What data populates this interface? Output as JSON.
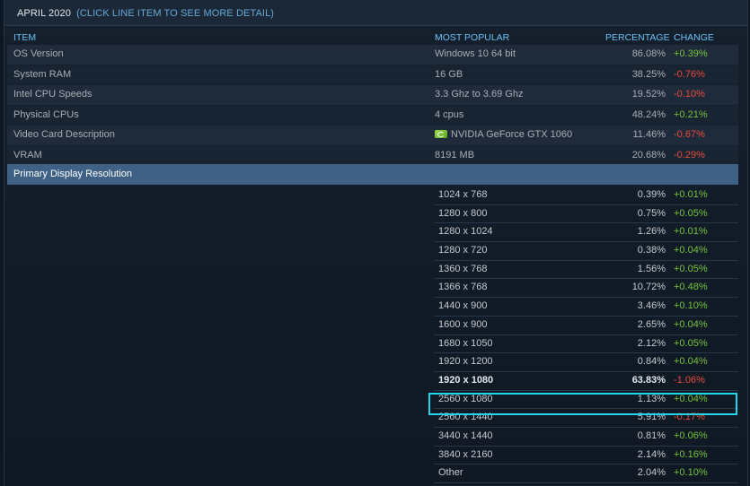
{
  "header": {
    "title": "APRIL 2020",
    "note": "(CLICK LINE ITEM TO SEE MORE DETAIL)"
  },
  "columns": {
    "item": "ITEM",
    "most_popular": "MOST POPULAR",
    "percentage": "PERCENTAGE",
    "change": "CHANGE"
  },
  "rows": [
    {
      "item": "OS Version",
      "popular": "Windows 10 64 bit",
      "percentage": "86.08%",
      "change": "+0.39%",
      "trend": "pos"
    },
    {
      "item": "System RAM",
      "popular": "16 GB",
      "percentage": "38.25%",
      "change": "-0.76%",
      "trend": "neg"
    },
    {
      "item": "Intel CPU Speeds",
      "popular": "3.3 Ghz to 3.69 Ghz",
      "percentage": "19.52%",
      "change": "-0.10%",
      "trend": "neg"
    },
    {
      "item": "Physical CPUs",
      "popular": "4 cpus",
      "percentage": "48.24%",
      "change": "+0.21%",
      "trend": "pos"
    },
    {
      "item": "Video Card Description",
      "popular": "NVIDIA GeForce GTX 1060",
      "percentage": "11.46%",
      "change": "-0.67%",
      "trend": "neg",
      "icon": "nvidia-logo-icon"
    },
    {
      "item": "VRAM",
      "popular": "8191 MB",
      "percentage": "20.68%",
      "change": "-0.29%",
      "trend": "neg"
    }
  ],
  "section": {
    "label": "Primary Display Resolution"
  },
  "resolutions": [
    {
      "res": "1024 x 768",
      "percentage": "0.39%",
      "change": "+0.01%",
      "trend": "pos"
    },
    {
      "res": "1280 x 800",
      "percentage": "0.75%",
      "change": "+0.05%",
      "trend": "pos"
    },
    {
      "res": "1280 x 1024",
      "percentage": "1.26%",
      "change": "+0.01%",
      "trend": "pos"
    },
    {
      "res": "1280 x 720",
      "percentage": "0.38%",
      "change": "+0.04%",
      "trend": "pos"
    },
    {
      "res": "1360 x 768",
      "percentage": "1.56%",
      "change": "+0.05%",
      "trend": "pos"
    },
    {
      "res": "1366 x 768",
      "percentage": "10.72%",
      "change": "+0.48%",
      "trend": "pos"
    },
    {
      "res": "1440 x 900",
      "percentage": "3.46%",
      "change": "+0.10%",
      "trend": "pos"
    },
    {
      "res": "1600 x 900",
      "percentage": "2.65%",
      "change": "+0.04%",
      "trend": "pos"
    },
    {
      "res": "1680 x 1050",
      "percentage": "2.12%",
      "change": "+0.05%",
      "trend": "pos"
    },
    {
      "res": "1920 x 1200",
      "percentage": "0.84%",
      "change": "+0.04%",
      "trend": "pos"
    },
    {
      "res": "1920 x 1080",
      "percentage": "63.83%",
      "change": "-1.06%",
      "trend": "neg",
      "bold": true
    },
    {
      "res": "2560 x 1080",
      "percentage": "1.13%",
      "change": "+0.04%",
      "trend": "pos"
    },
    {
      "res": "2560 x 1440",
      "percentage": "5.91%",
      "change": "-0.17%",
      "trend": "neg",
      "highlighted": true
    },
    {
      "res": "3440 x 1440",
      "percentage": "0.81%",
      "change": "+0.06%",
      "trend": "pos"
    },
    {
      "res": "3840 x 2160",
      "percentage": "2.14%",
      "change": "+0.16%",
      "trend": "pos"
    },
    {
      "res": "Other",
      "percentage": "2.04%",
      "change": "+0.10%",
      "trend": "pos"
    }
  ],
  "colors": {
    "positive": "#76c23c",
    "negative": "#ea4b3c",
    "header_text": "#67c1f5",
    "section_bg": "#3f6185",
    "highlight_border": "#22d6ea"
  }
}
